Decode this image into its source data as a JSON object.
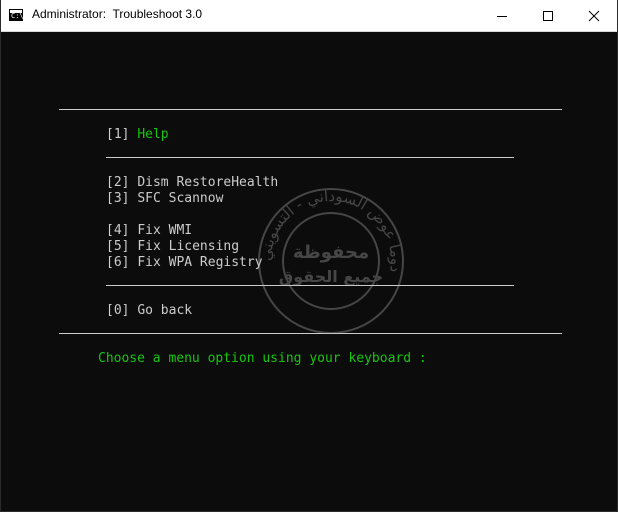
{
  "window": {
    "title_prefix": "Administrator:",
    "title": "Troubleshoot 3.0",
    "icon": "console-icon",
    "icon_text": "C:\\."
  },
  "controls": {
    "minimize_icon": "minimize-icon",
    "maximize_icon": "maximize-icon",
    "close_icon": "close-icon"
  },
  "menu": {
    "help": {
      "key": "[1]",
      "label": "Help"
    },
    "items_group1": [
      {
        "key": "[2]",
        "label": "Dism RestoreHealth"
      },
      {
        "key": "[3]",
        "label": "SFC Scannow"
      }
    ],
    "items_group2": [
      {
        "key": "[4]",
        "label": "Fix WMI"
      },
      {
        "key": "[5]",
        "label": "Fix Licensing"
      },
      {
        "key": "[6]",
        "label": "Fix WPA Registry"
      }
    ],
    "back": {
      "key": "[0]",
      "label": "Go back"
    }
  },
  "prompt": "Choose a menu option using your keyboard :",
  "colors": {
    "background": "#0c0c0c",
    "text": "#cccccc",
    "accent_green": "#16c60c",
    "titlebar": "#ffffff"
  },
  "watermark": {
    "ring_text": "دوما عوض السوداني - التسويني",
    "center_line1": "محفوظة",
    "center_line2": "جميع الحقوق"
  }
}
